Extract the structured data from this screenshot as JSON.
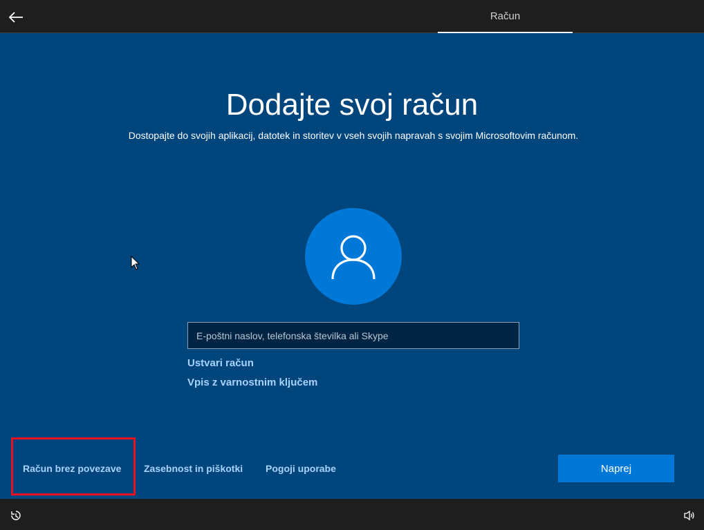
{
  "header": {
    "tab_label": "Račun"
  },
  "main": {
    "title": "Dodajte svoj račun",
    "subtitle": "Dostopajte do svojih aplikacij, datotek in storitev v vseh svojih napravah s svojim Microsoftovim računom.",
    "email_placeholder": "E-poštni naslov, telefonska številka ali Skype",
    "create_account_link": "Ustvari račun",
    "security_key_link": "Vpis z varnostnim ključem"
  },
  "footer_links": {
    "offline_account": "Račun brez povezave",
    "privacy": "Zasebnost in piškotki",
    "terms": "Pogoji uporabe"
  },
  "next_button": "Naprej",
  "icons": {
    "back": "back-arrow-icon",
    "avatar": "user-icon",
    "ease_of_access": "ease-of-access-icon",
    "volume": "volume-icon"
  },
  "colors": {
    "background": "#00457b",
    "accent": "#0078d7",
    "link": "#a9d3ff",
    "highlight": "#e81123",
    "bar": "#1e1e1e"
  }
}
